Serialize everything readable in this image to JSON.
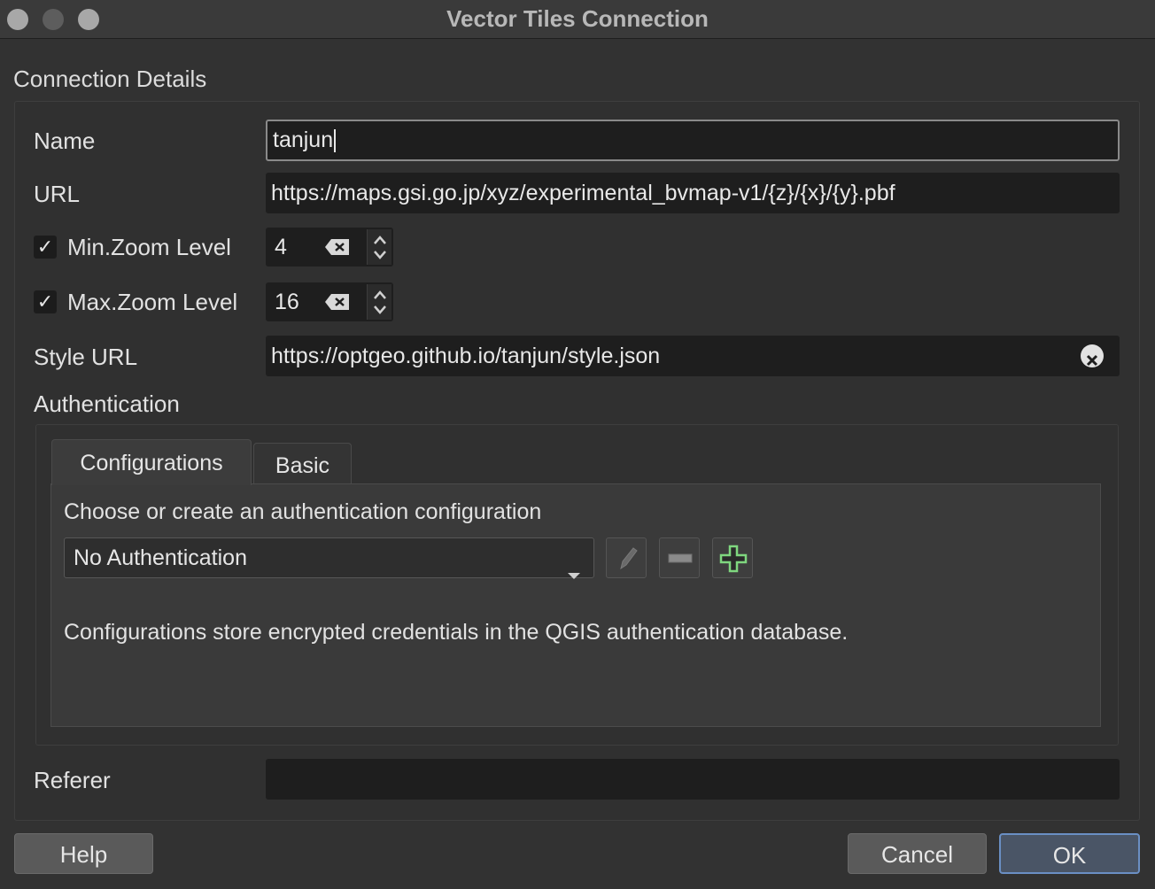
{
  "window": {
    "title": "Vector Tiles Connection"
  },
  "group": {
    "title": "Connection Details"
  },
  "fields": {
    "name": {
      "label": "Name",
      "value": "tanjun"
    },
    "url": {
      "label": "URL",
      "value": "https://maps.gsi.go.jp/xyz/experimental_bvmap-v1/{z}/{x}/{y}.pbf"
    },
    "min_zoom": {
      "label": "Min.Zoom Level",
      "checked": true,
      "value": "4"
    },
    "max_zoom": {
      "label": "Max.Zoom Level",
      "checked": true,
      "value": "16"
    },
    "style_url": {
      "label": "Style URL",
      "value": "https://optgeo.github.io/tanjun/style.json"
    },
    "referer": {
      "label": "Referer",
      "value": ""
    }
  },
  "auth": {
    "label": "Authentication",
    "tabs": [
      {
        "label": "Configurations",
        "active": true
      },
      {
        "label": "Basic",
        "active": false
      }
    ],
    "prompt": "Choose or create an authentication configuration",
    "selected": "No Authentication",
    "note": "Configurations store encrypted credentials in the QGIS authentication database."
  },
  "buttons": {
    "help": "Help",
    "cancel": "Cancel",
    "ok": "OK"
  },
  "check_glyph": "✓",
  "colors": {
    "accent": "#6a8fc4",
    "add_icon": "#7fd77f"
  }
}
